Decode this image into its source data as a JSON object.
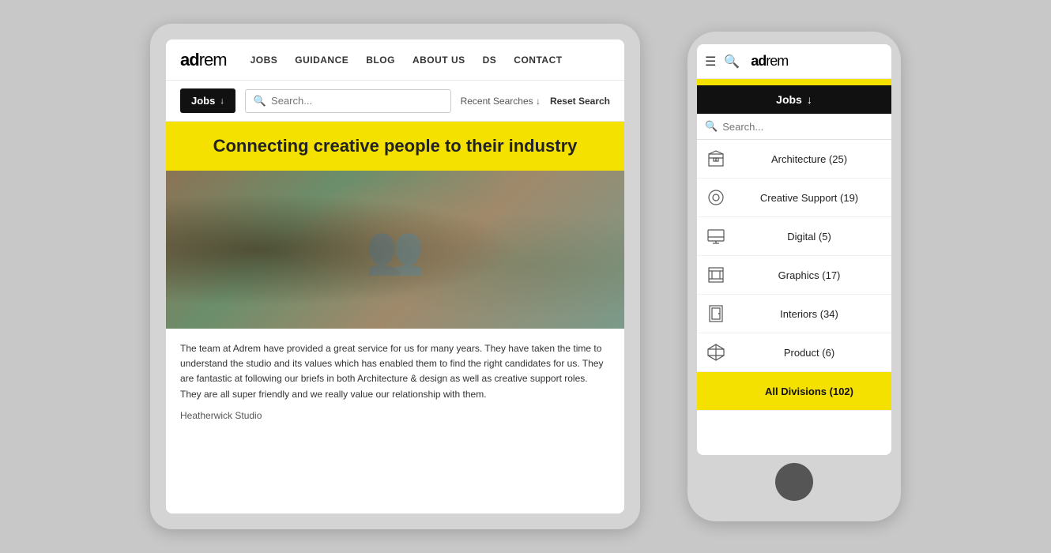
{
  "brand": {
    "logo_bold": "ad",
    "logo_light": "rem"
  },
  "tablet": {
    "nav": {
      "links": [
        "JOBS",
        "GUIDANCE",
        "BLOG",
        "ABOUT US",
        "DS",
        "CONTACT"
      ]
    },
    "search_bar": {
      "jobs_label": "Jobs",
      "search_placeholder": "Search...",
      "recent_searches_label": "Recent Searches ↓",
      "reset_label": "Reset Search"
    },
    "hero": {
      "headline": "Connecting creative people to their industry"
    },
    "testimonial": {
      "text": "The team at Adrem have provided a great service for us for many years. They have taken the time to understand the studio and its values which has enabled them to find the right candidates for us. They are fantastic at following our briefs in both Architecture & design as well as creative support roles. They are all super friendly and we really value our relationship with them.",
      "studio": "Heatherwick Studio"
    }
  },
  "phone": {
    "search_placeholder": "Search...",
    "jobs_label": "Jobs",
    "categories": [
      {
        "name": "Architecture (25)",
        "icon": "building"
      },
      {
        "name": "Creative Support (19)",
        "icon": "circle-dot"
      },
      {
        "name": "Digital (5)",
        "icon": "monitor"
      },
      {
        "name": "Graphics (17)",
        "icon": "frame"
      },
      {
        "name": "Interiors (34)",
        "icon": "door"
      },
      {
        "name": "Product (6)",
        "icon": "cube"
      },
      {
        "name": "All Divisions (102)",
        "icon": "all",
        "active": true
      }
    ]
  },
  "colors": {
    "yellow": "#f5e100",
    "black": "#111111",
    "white": "#ffffff",
    "gray_bg": "#c8c8c8",
    "device_bg": "#d4d4d4"
  }
}
